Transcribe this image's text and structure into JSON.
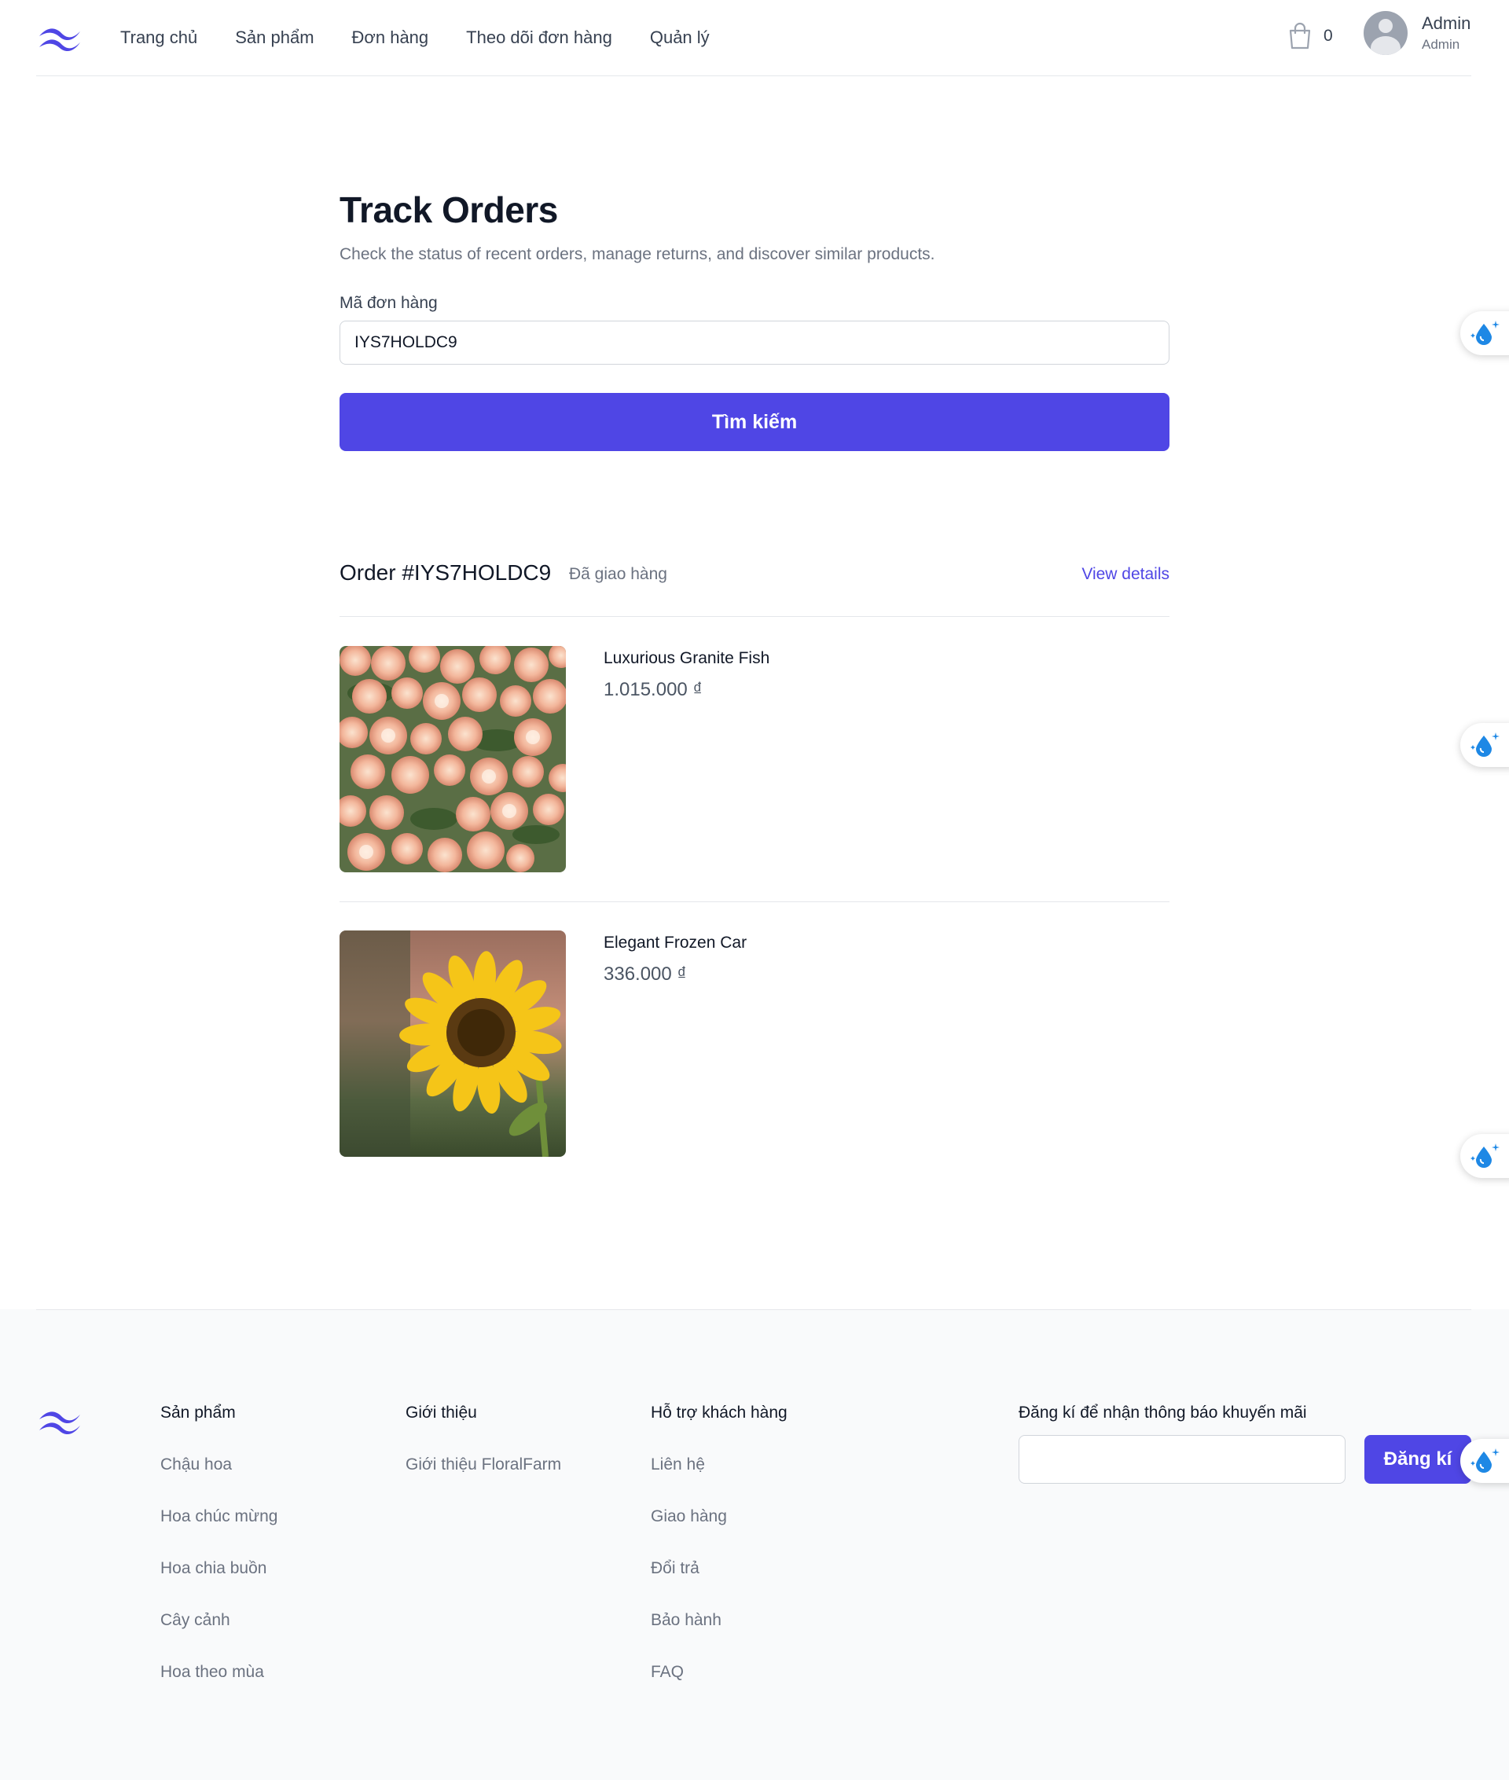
{
  "header": {
    "nav": [
      "Trang chủ",
      "Sản phẩm",
      "Đơn hàng",
      "Theo dõi đơn hàng",
      "Quản lý"
    ],
    "cart_count": "0",
    "user_name": "Admin",
    "user_role": "Admin"
  },
  "main": {
    "title": "Track Orders",
    "subtitle": "Check the status of recent orders, manage returns, and discover similar products.",
    "order_code_label": "Mã đơn hàng",
    "order_code_value": "IYS7HOLDC9",
    "search_button": "Tìm kiếm"
  },
  "order": {
    "id_text": "Order #IYS7HOLDC9",
    "status": "Đã giao hàng",
    "view_details": "View details",
    "items": [
      {
        "name": "Luxurious Granite Fish",
        "price": "1.015.000 ₫",
        "image": "peach-roses-photo"
      },
      {
        "name": "Elegant Frozen Car",
        "price": "336.000 ₫",
        "image": "sunflower-photo"
      }
    ]
  },
  "footer": {
    "columns": [
      {
        "title": "Sản phẩm",
        "links": [
          "Chậu hoa",
          "Hoa chúc mừng",
          "Hoa chia buồn",
          "Cây cảnh",
          "Hoa theo mùa"
        ]
      },
      {
        "title": "Giới thiệu",
        "links": [
          "Giới thiệu FloralFarm"
        ]
      },
      {
        "title": "Hỗ trợ khách hàng",
        "links": [
          "Liên hệ",
          "Giao hàng",
          "Đổi trả",
          "Bảo hành",
          "FAQ"
        ]
      }
    ],
    "newsletter_title": "Đăng kí để nhận thông báo khuyến mãi",
    "newsletter_button": "Đăng kí"
  },
  "colors": {
    "accent": "#4f46e5",
    "text_primary": "#111827",
    "text_secondary": "#6b7280",
    "footer_bg": "#f9fafb"
  }
}
